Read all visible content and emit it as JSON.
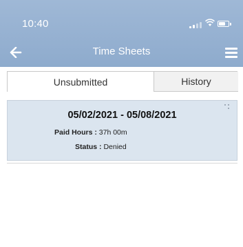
{
  "status_bar": {
    "time": "10:40"
  },
  "header": {
    "title": "Time Sheets"
  },
  "tabs": [
    {
      "label": "Unsubmitted",
      "active": true
    },
    {
      "label": "History",
      "active": false
    }
  ],
  "timesheet": {
    "date_range": "05/02/2021 - 05/08/2021",
    "paid_hours_label": "Paid Hours :",
    "paid_hours_value": "37h 00m",
    "status_label": "Status :",
    "status_value": "Denied"
  },
  "colors": {
    "header": "#94afd1",
    "card": "#dbe5ef"
  },
  "icons": {
    "back": "arrow-left-icon",
    "menu": "hamburger-menu-icon",
    "drag": "drag-handle-icon"
  }
}
